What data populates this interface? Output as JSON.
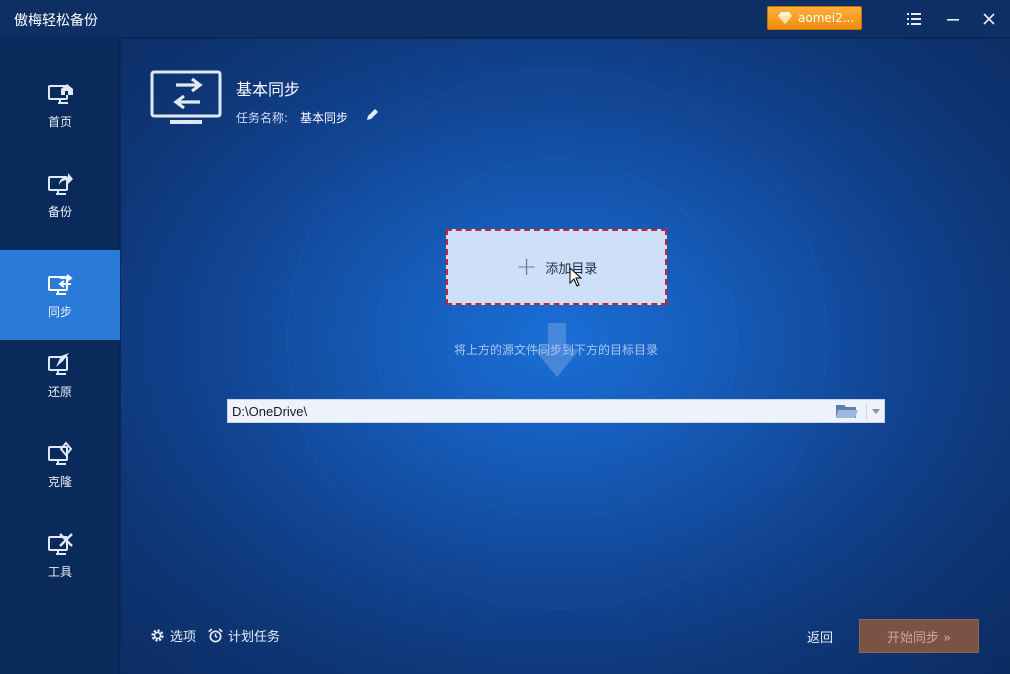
{
  "app": {
    "title": "傲梅轻松备份",
    "user_badge": "aomei2..."
  },
  "sidebar": {
    "items": [
      {
        "label": "首页",
        "icon": "home-monitor-icon",
        "active": false
      },
      {
        "label": "备份",
        "icon": "backup-monitor-icon",
        "active": false
      },
      {
        "label": "同步",
        "icon": "sync-monitor-icon",
        "active": true
      },
      {
        "label": "还原",
        "icon": "restore-monitor-icon",
        "active": false
      },
      {
        "label": "克隆",
        "icon": "clone-monitor-icon",
        "active": false
      },
      {
        "label": "工具",
        "icon": "tools-monitor-icon",
        "active": false
      }
    ]
  },
  "header": {
    "title": "基本同步",
    "task_name_label": "任务名称:",
    "task_name_value": "基本同步"
  },
  "source": {
    "add_dir_label": "添加目录"
  },
  "hint": "将上方的源文件同步到下方的目标目录",
  "destination": {
    "path": "D:\\OneDrive\\"
  },
  "footer": {
    "options_label": "选项",
    "schedule_label": "计划任务",
    "back_label": "返回",
    "start_label": "开始同步 »"
  },
  "colors": {
    "active_nav": "#2a7ad8",
    "badge": "#f39a1d",
    "start_button": "#7b5345",
    "dashed_border": "#d0202a"
  }
}
